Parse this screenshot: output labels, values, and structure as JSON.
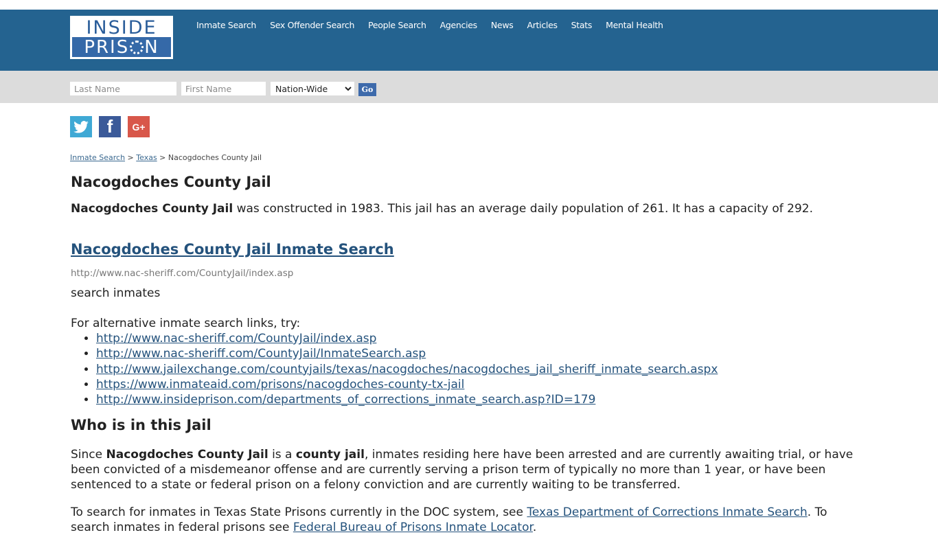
{
  "header": {
    "logo": {
      "line1": "INSIDE",
      "line2_pre": "PRIS",
      "line2_post": "N"
    },
    "nav": [
      {
        "label": "Inmate Search"
      },
      {
        "label": "Sex Offender Search"
      },
      {
        "label": "People Search"
      },
      {
        "label": "Agencies"
      },
      {
        "label": "News"
      },
      {
        "label": "Articles"
      },
      {
        "label": "Stats"
      },
      {
        "label": "Mental Health"
      }
    ]
  },
  "search": {
    "last_placeholder": "Last Name",
    "first_placeholder": "First Name",
    "scope_selected": "Nation-Wide",
    "go_label": "Go"
  },
  "social": {
    "twitter": "t",
    "facebook": "f",
    "googleplus": "G+"
  },
  "breadcrumb": {
    "items": [
      {
        "label": "Inmate Search"
      },
      {
        "label": "Texas"
      }
    ],
    "separator": ">",
    "current": "Nacogdoches County Jail"
  },
  "main": {
    "title": "Nacogdoches County Jail",
    "intro_bold": "Nacogdoches County Jail",
    "intro_rest": " was constructed in 1983. This jail has an average daily population of 261. It has a capacity of 292.",
    "search_link": "Nacogdoches County Jail Inmate Search",
    "search_url": "http://www.nac-sheriff.com/CountyJail/index.asp",
    "search_desc": "search inmates",
    "alt_intro": "For alternative inmate search links, try:",
    "alt_links": [
      "http://www.nac-sheriff.com/CountyJail/index.asp",
      "http://www.nac-sheriff.com/CountyJail/InmateSearch.asp",
      "http://www.jailexchange.com/countyjails/texas/nacogdoches/nacogdoches_jail_sheriff_inmate_search.aspx",
      "https://www.inmateaid.com/prisons/nacogdoches-county-tx-jail",
      "http://www.insideprison.com/departments_of_corrections_inmate_search.asp?ID=179"
    ],
    "who_heading": "Who is in this Jail",
    "who_p1": "Since ",
    "who_b1": "Nacogdoches County Jail",
    "who_p2": " is a ",
    "who_b2": "county jail",
    "who_p3": ", inmates residing here have been arrested and are currently awaiting trial, or have been convicted of a misdemeanor offense and are currently serving a prison term of typically no more than 1 year, or have been sentenced to a state or federal prison on a felony conviction and are currently waiting to be transferred.",
    "doc_p1": "To search for inmates in Texas State Prisons currently in the DOC system, see ",
    "doc_link1": "Texas Department of Corrections Inmate Search",
    "doc_p2": ". To search inmates in federal prisons see ",
    "doc_link2": "Federal Bureau of Prisons Inmate Locator",
    "doc_p3": "."
  }
}
